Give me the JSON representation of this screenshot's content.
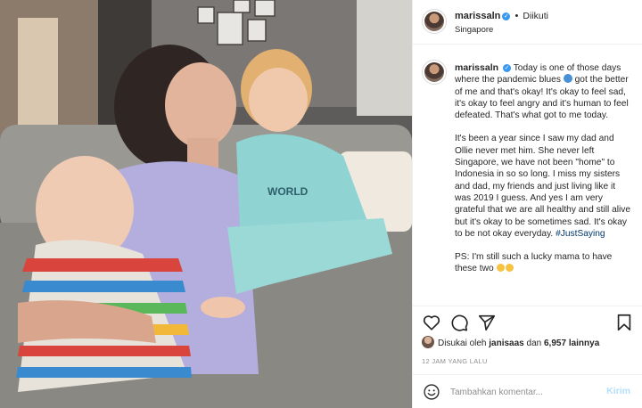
{
  "post": {
    "photo_alt": "mother kissing toddler, holding baby",
    "shirt_text": "WORLD"
  },
  "header": {
    "username": "marissaln",
    "verified": "✓",
    "separator": "•",
    "follow_label": "Diikuti",
    "location": "Singapore"
  },
  "caption": {
    "username": "marissaln",
    "verified": "✓",
    "paragraph1_a": "Today is one of those days where the pandemic blues",
    "paragraph1_b": "got the better of me and that's okay! It's okay to feel sad, it's okay to feel angry and it's human to feel defeated. That's what got to me today.",
    "paragraph2": "It's been a year since I saw my dad and Ollie never met him. She never left Singapore, we have not been \"home\" to Indonesia in so so long. I miss my sisters and dad, my friends and just living like it was 2019 I guess. And yes I am very grateful that we are all healthy and still alive but it's okay to be sometimes sad. It's okay to be not okay everyday.",
    "hashtag": "#JustSaying",
    "paragraph3": "PS: I'm still such a lucky mama to have these two"
  },
  "actions": {
    "like_icon": "heart-icon",
    "comment_icon": "comment-icon",
    "share_icon": "paper-plane-icon",
    "save_icon": "bookmark-icon"
  },
  "likes": {
    "prefix": "Disukai oleh",
    "user": "janisaas",
    "connector": "dan",
    "count": "6,957",
    "suffix": "lainnya"
  },
  "timestamp": "12 JAM YANG LALU",
  "comment": {
    "placeholder": "Tambahkan komentar...",
    "send_label": "Kirim",
    "emoji_icon": "smiley-icon"
  },
  "colors": {
    "accent": "#3897f0",
    "send_disabled": "#b2dffc",
    "border": "#efefef",
    "secondary_text": "#8e8e8e"
  }
}
